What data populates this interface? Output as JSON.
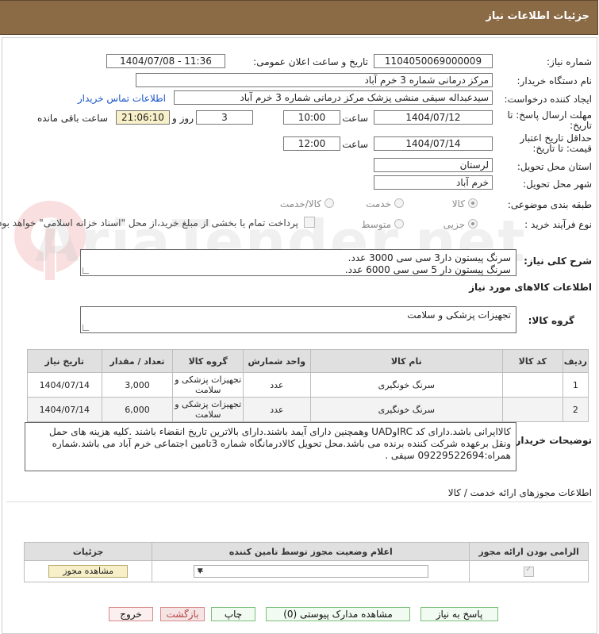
{
  "header": {
    "title": "جزئیات اطلاعات نیاز"
  },
  "watermark": {
    "text": "AriaTender.net"
  },
  "form": {
    "need_number_label": "شماره نیاز:",
    "need_number": "1104050069000009",
    "announce_label": "تاریخ و ساعت اعلان عمومی:",
    "announce_value": "1404/07/08 - 11:36",
    "buyer_org_label": "نام دستگاه خریدار:",
    "buyer_org": "مرکز درمانی شماره 3 خرم آباد",
    "requester_label": "ایجاد کننده درخواست:",
    "requester": "سیدعبداله سیفی منشی پزشک مرکز درمانی شماره 3 خرم آباد",
    "buyer_contact_link": "اطلاعات تماس خریدار",
    "deadline_label_1": "مهلت ارسال پاسخ: تا",
    "deadline_label_2": "تاریخ:",
    "deadline_date": "1404/07/12",
    "time_label": "ساعت",
    "deadline_time": "10:00",
    "days_value": "3",
    "days_label": "روز و",
    "remaining_time": "21:06:10",
    "remaining_label": "ساعت باقی مانده",
    "validity_label_1": "حداقل تاریخ اعتبار",
    "validity_label_2": "قیمت: تا تاریخ:",
    "validity_date": "1404/07/14",
    "validity_time": "12:00",
    "province_label": "استان محل تحویل:",
    "province": "لرستان",
    "city_label": "شهر محل تحویل:",
    "city": "خرم آباد",
    "category_label": "طبقه بندی موضوعی:",
    "category_options": [
      "کالا",
      "خدمت",
      "کالا/خدمت"
    ],
    "category_selected": "کالا",
    "process_label": "نوع فرآیند خرید :",
    "process_options": [
      "جزیی",
      "متوسط"
    ],
    "process_selected": "جزیی",
    "payment_note": "پرداخت تمام یا بخشی از مبلغ خرید،از محل \"اسناد خزانه اسلامی\" خواهد بود."
  },
  "summary": {
    "label": "شرح کلی نیاز:",
    "line1": "سرنگ پیستون دار3 سی سی 3000 عدد.",
    "line2": "سرنگ پیستون دار 5 سی سی 6000 عدد."
  },
  "goods_info_title": "اطلاعات کالاهای مورد نیاز",
  "goods_group": {
    "label": "گروه کالا:",
    "value": "تجهیزات پزشکی و سلامت"
  },
  "items_table": {
    "headers": [
      "ردیف",
      "کد کالا",
      "نام کالا",
      "واحد شمارش",
      "گروه کالا",
      "تعداد / مقدار",
      "تاریخ نیاز"
    ],
    "rows": [
      [
        "1",
        "",
        "سرنگ خونگیری",
        "عدد",
        "تجهیزات پزشکی و سلامت",
        "3,000",
        "1404/07/14"
      ],
      [
        "2",
        "",
        "سرنگ خونگیری",
        "عدد",
        "تجهیزات پزشکی و سلامت",
        "6,000",
        "1404/07/14"
      ]
    ]
  },
  "buyer_notes": {
    "label": "توضیحات خریدار:",
    "text": "کالاایرانی باشد.دارای کد IRCوUAD وهمچنین دارای آیمد باشند.دارای بالاترین تاریخ انقضاء باشند .کلیه هزینه های حمل ونقل برعهده شرکت کننده برنده می باشد.محل تحویل کالادرمانگاه شماره 3تامین اجتماعی خرم آباد می باشد.شماره همراه:09229522694 سیفی ."
  },
  "permits": {
    "title": "اطلاعات مجوزهای ارائه خدمت / کالا",
    "headers": [
      "الزامی بودن ارائه مجوز",
      "اعلام وضعیت مجوز توسط تامین کننده",
      "جزئیات"
    ],
    "select_value": "--",
    "view_button": "مشاهده مجوز"
  },
  "buttons": {
    "reply": "پاسخ به نیاز",
    "attachments": "مشاهده مدارک پیوستی (0)",
    "print": "چاپ",
    "back": "بازگشت",
    "exit": "خروج"
  }
}
